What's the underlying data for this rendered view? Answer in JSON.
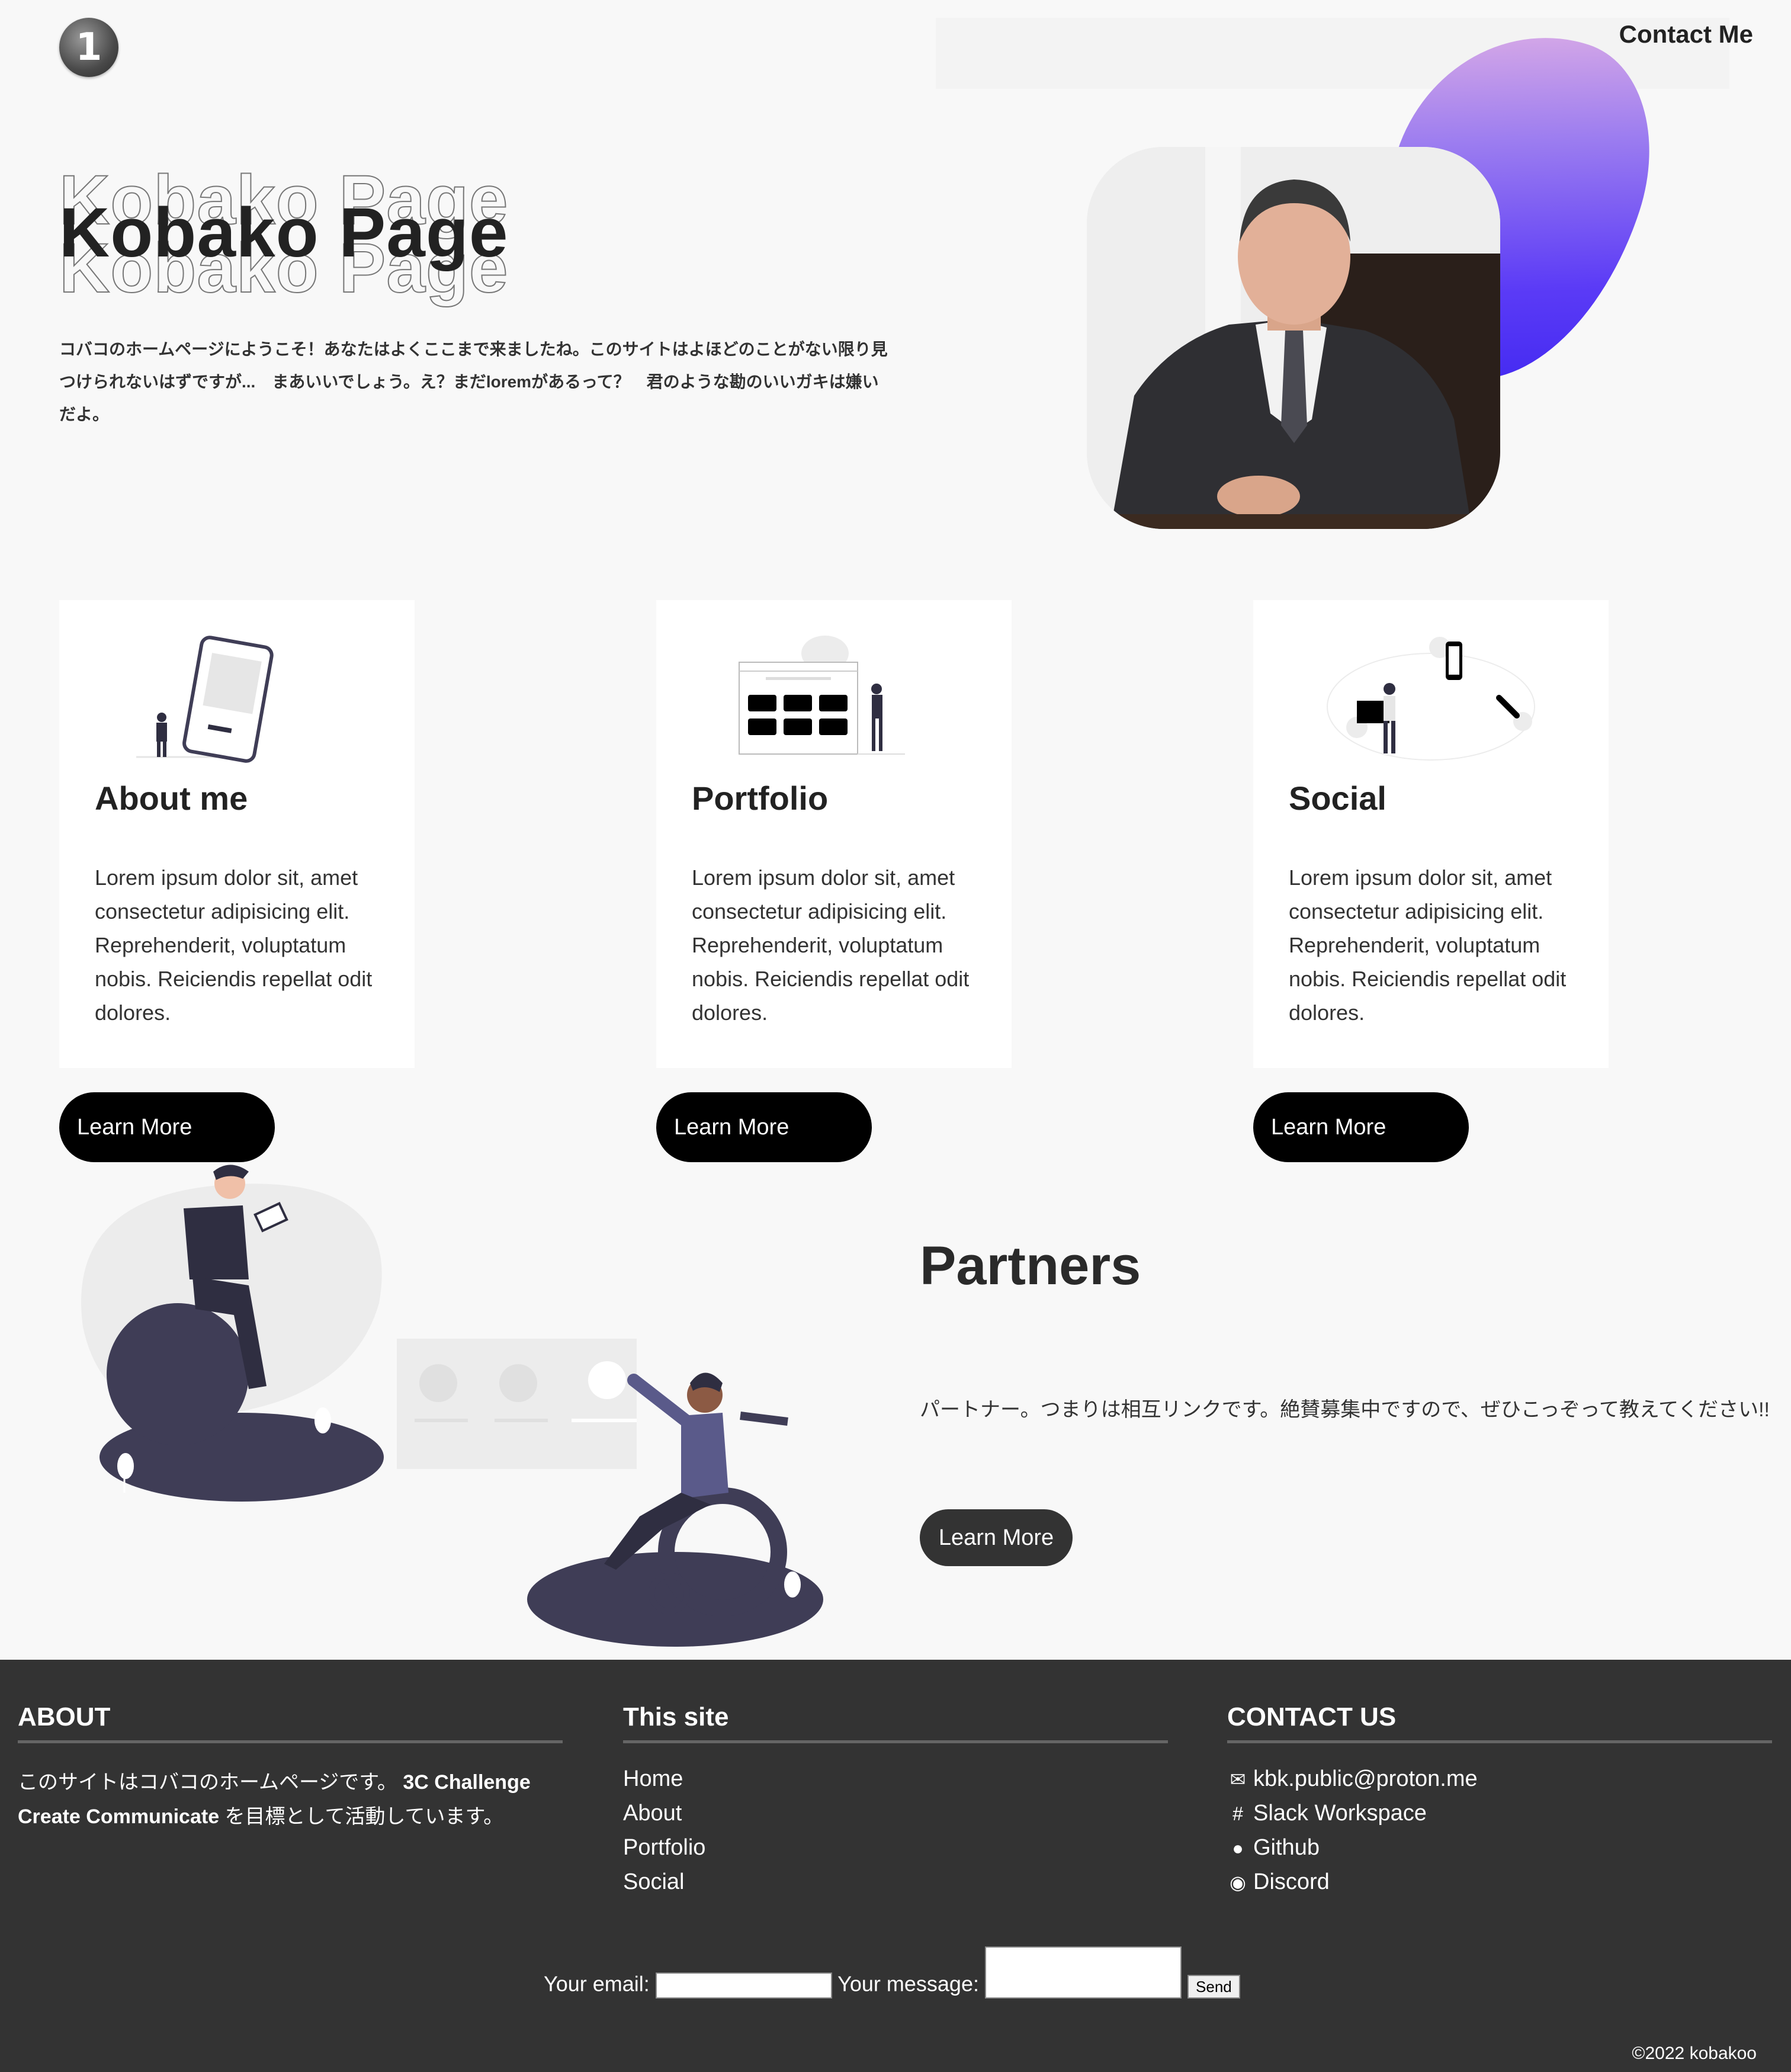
{
  "header": {
    "logo_glyph": "1",
    "contact_label": "Contact Me"
  },
  "hero": {
    "title": "Kobako Page",
    "intro": "コバコのホームページにようこそ！あなたはよくここまで来ましたね。このサイトはよほどのことがない限り見つけられないはずですが...　まあいいでしょう。え？まだloremがあるって？　君のような勘のいいガキは嫌いだよ。"
  },
  "cards": [
    {
      "title": "About me",
      "text": "Lorem ipsum dolor sit, amet consectetur adipisicing elit. Reprehenderit, voluptatum nobis. Reiciendis repellat odit dolores.",
      "button": "Learn More"
    },
    {
      "title": "Portfolio",
      "text": "Lorem ipsum dolor sit, amet consectetur adipisicing elit. Reprehenderit, voluptatum nobis. Reiciendis repellat odit dolores.",
      "button": "Learn More"
    },
    {
      "title": "Social",
      "text": "Lorem ipsum dolor sit, amet consectetur adipisicing elit. Reprehenderit, voluptatum nobis. Reiciendis repellat odit dolores.",
      "button": "Learn More"
    }
  ],
  "partners": {
    "title": "Partners",
    "text": "パートナー。つまりは相互リンクです。絶賛募集中ですので、ぜひこっぞって教えてください!!",
    "button": "Learn More"
  },
  "footer": {
    "about": {
      "heading": "ABOUT",
      "text_prefix": "このサイトはコバコのホームページです。",
      "bold1": "3C Challenge",
      "bold2": "Create Communicate",
      "text_suffix": " を目標として活動しています。"
    },
    "site": {
      "heading": "This site",
      "links": [
        "Home",
        "About",
        "Portfolio",
        "Social"
      ]
    },
    "contact": {
      "heading": "CONTACT US",
      "items": [
        {
          "icon": "envelope-icon",
          "label": "kbk.public@proton.me"
        },
        {
          "icon": "slack-icon",
          "label": "Slack Workspace"
        },
        {
          "icon": "github-icon",
          "label": "Github"
        },
        {
          "icon": "discord-icon",
          "label": "Discord"
        }
      ]
    },
    "form": {
      "email_label": "Your email:",
      "message_label": "Your message:",
      "send_label": "Send"
    },
    "copyright": "©2022 kobakoo"
  },
  "colors": {
    "background": "#f8f8f8",
    "footer": "#333333",
    "button": "#000000",
    "blob_start": "#e8b6e4",
    "blob_end": "#3d25f0"
  }
}
